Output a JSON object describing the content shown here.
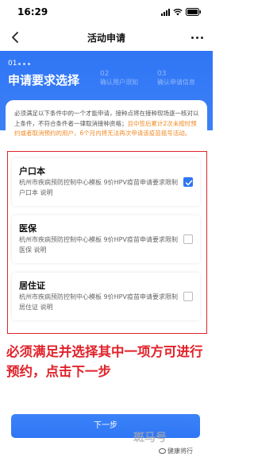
{
  "status_bar": {
    "time": "16:29"
  },
  "nav": {
    "title": "活动申请"
  },
  "steps": {
    "current_number": "01",
    "current_title": "申请要求选择",
    "step2_number": "02",
    "step2_label": "确认用户须知",
    "step3_number": "03",
    "step3_label": "确认申请信息"
  },
  "notice": {
    "main": "必须满足以下条件中的一个才能申请，接种点将在接种现场逐一核对以上条件，不符合条件者一律取消接种资格；",
    "warning": "且中签后累计2次未按时预约或者取消预约的用户，6个月内将无法再次申请该疫苗摇号活动。"
  },
  "options": [
    {
      "title": "户口本",
      "desc": "杭州市疾病预防控制中心模板 9价HPV疫苗申请要求限制 户口本 说明",
      "checked": true
    },
    {
      "title": "医保",
      "desc": "杭州市疾病预防控制中心模板 9价HPV疫苗申请要求限制 医保 说明",
      "checked": false
    },
    {
      "title": "居住证",
      "desc": "杭州市疾病预防控制中心模板 9价HPV疫苗申请要求限制 居住证 说明",
      "checked": false
    }
  ],
  "annotation": "必须满足并选择其中一项方可进行预约，点击下一步",
  "next_button": "下一步",
  "watermarks": {
    "a": "斑马号",
    "b": "健康将行"
  },
  "colors": {
    "primary": "#2f76f5",
    "annotation_red": "#e0222b",
    "warning_orange": "#f08a24"
  }
}
